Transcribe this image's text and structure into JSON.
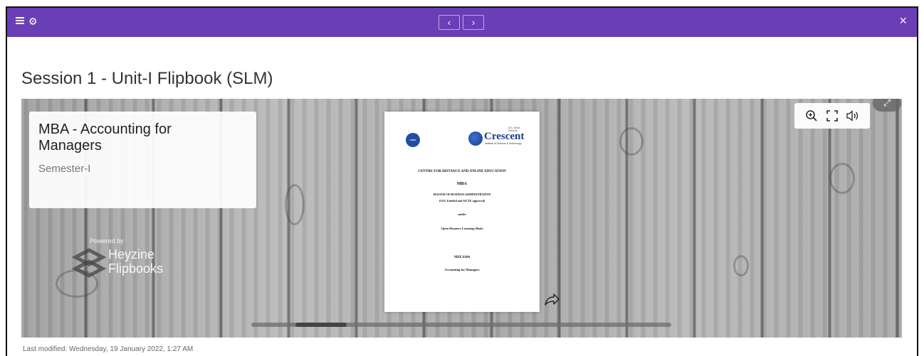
{
  "topbar": {
    "menu_icon": "hamburger-icon",
    "settings_icon": "gear-icon",
    "prev_label": "‹",
    "next_label": "›",
    "close_label": "×",
    "color": "#6a3fb5"
  },
  "page_title": "Session 1 - Unit-I Flipbook (SLM)",
  "flipbook": {
    "card": {
      "title": "MBA - Accounting for Managers",
      "subtitle": "Semester-I"
    },
    "powered": {
      "small": "Powered by",
      "brand_line1": "Heyzine",
      "brand_line2": "Flipbooks"
    },
    "cover": {
      "cdoe_badge": "CDOE",
      "crescent_name": "Crescent",
      "crescent_above": "B.S. Abdur Rahman",
      "crescent_institute": "Institute of Science & Technology",
      "centre": "CENTRE FOR DISTANCE AND ONLINE EDUCATION",
      "program": "MBA",
      "program_full": "MASTER OF BUSINESS ADMINISTRATION",
      "approval": "(UGC Entitled and AICTE approved)",
      "under": "under",
      "mode": "Open Distance Learning Mode",
      "course_code": "MSE 6104",
      "course_name": "Accounting for Managers"
    },
    "tools": [
      "zoom-in-icon",
      "fullscreen-icon",
      "sound-icon"
    ],
    "scroll_progress": 0.12
  },
  "footer": {
    "last_modified": "Last modified: Wednesday, 19 January 2022, 1:27 AM"
  }
}
